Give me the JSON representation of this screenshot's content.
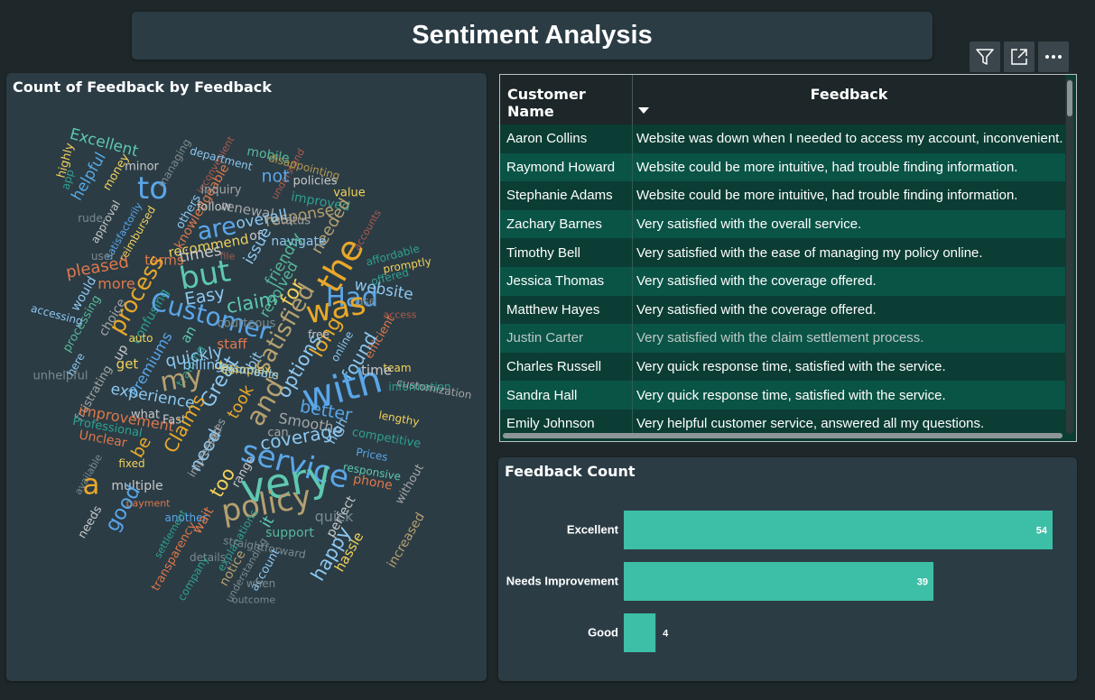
{
  "header": {
    "title": "Sentiment Analysis"
  },
  "toolbar": {
    "icons": [
      "filter-icon",
      "focus-mode-icon",
      "more-options-icon"
    ]
  },
  "wordcloud": {
    "title": "Count of Feedback by Feedback",
    "words": [
      {
        "t": "Excellent",
        "c": "#5ec8b0",
        "s": 17,
        "r": 15
      },
      {
        "t": "highly",
        "c": "#f3d25a",
        "s": 13,
        "r": -75
      },
      {
        "t": "app",
        "c": "#2fa08f",
        "s": 12,
        "r": -75
      },
      {
        "t": "helpful",
        "c": "#58a8e0",
        "s": 17,
        "r": -60
      },
      {
        "t": "money",
        "c": "#f3d25a",
        "s": 13,
        "r": -60
      },
      {
        "t": "minor",
        "c": "#c9c9c9",
        "s": 13,
        "r": 0
      },
      {
        "t": "to",
        "c": "#5aa6e8",
        "s": 34,
        "r": 0
      },
      {
        "t": "managing",
        "c": "#7a8a8f",
        "s": 12,
        "r": -60
      },
      {
        "t": "inconvenient",
        "c": "#b05a4a",
        "s": 11,
        "r": -60
      },
      {
        "t": "department",
        "c": "#8ec8f0",
        "s": 12,
        "r": 15
      },
      {
        "t": "mobile",
        "c": "#58b89a",
        "s": 14,
        "r": 10
      },
      {
        "t": "understand",
        "c": "#b05a4a",
        "s": 11,
        "r": -60
      },
      {
        "t": "not",
        "c": "#5aa6e8",
        "s": 19,
        "r": 0
      },
      {
        "t": "disappointing",
        "c": "#b59a50",
        "s": 12,
        "r": 15
      },
      {
        "t": "knowledgeable",
        "c": "#e0784a",
        "s": 14,
        "r": -60
      },
      {
        "t": "inquiry",
        "c": "#a5a5a5",
        "s": 13,
        "r": 0
      },
      {
        "t": "policies",
        "c": "#c9c9c9",
        "s": 13,
        "r": 0
      },
      {
        "t": "value",
        "c": "#f3d25a",
        "s": 13,
        "r": 0
      },
      {
        "t": "improved",
        "c": "#2fa08f",
        "s": 14,
        "r": 10
      },
      {
        "t": "follow",
        "c": "#c9c9c9",
        "s": 13,
        "r": 0
      },
      {
        "t": "renewal",
        "c": "#a5a5a5",
        "s": 15,
        "r": 10
      },
      {
        "t": "response",
        "c": "#b5a070",
        "s": 17,
        "r": -10
      },
      {
        "t": "rude",
        "c": "#7a8a8f",
        "s": 12,
        "r": 0
      },
      {
        "t": "approval",
        "c": "#c9c9c9",
        "s": 12,
        "r": -60
      },
      {
        "t": "satisfactorily",
        "c": "#5aa6e8",
        "s": 11,
        "r": -60
      },
      {
        "t": "reimbursed",
        "c": "#f3d25a",
        "s": 12,
        "r": -60
      },
      {
        "t": "others",
        "c": "#8ec8f0",
        "s": 13,
        "r": -60
      },
      {
        "t": "are",
        "c": "#5aa6e8",
        "s": 27,
        "r": -10
      },
      {
        "t": "overall",
        "c": "#8ec8f0",
        "s": 17,
        "r": -10
      },
      {
        "t": "status",
        "c": "#a5a5a5",
        "s": 13,
        "r": 0
      },
      {
        "t": "needed",
        "c": "#b5a070",
        "s": 18,
        "r": -60
      },
      {
        "t": "accounts",
        "c": "#b05a4a",
        "s": 11,
        "r": -60
      },
      {
        "t": "recommend",
        "c": "#f3d25a",
        "s": 15,
        "r": -10
      },
      {
        "t": "of",
        "c": "#c9c9c9",
        "s": 14,
        "r": 0
      },
      {
        "t": "navigate",
        "c": "#8ec8f0",
        "s": 14,
        "r": 0
      },
      {
        "t": "the",
        "c": "#e8a82a",
        "s": 38,
        "r": -60
      },
      {
        "t": "affordable",
        "c": "#2fa08f",
        "s": 12,
        "r": -15
      },
      {
        "t": "user",
        "c": "#7a8a8f",
        "s": 12,
        "r": 0
      },
      {
        "t": "times",
        "c": "#c9c9c9",
        "s": 17,
        "r": -10
      },
      {
        "t": "file",
        "c": "#b05a4a",
        "s": 11,
        "r": 0
      },
      {
        "t": "issue",
        "c": "#8ec8f0",
        "s": 17,
        "r": -60
      },
      {
        "t": "friendly",
        "c": "#58b89a",
        "s": 17,
        "r": -60
      },
      {
        "t": "promptly",
        "c": "#f3d25a",
        "s": 12,
        "r": -10
      },
      {
        "t": "pleased",
        "c": "#e0784a",
        "s": 18,
        "r": -10
      },
      {
        "t": "terms",
        "c": "#e0784a",
        "s": 15,
        "r": 0
      },
      {
        "t": "but",
        "c": "#5ec8b0",
        "s": 34,
        "r": -10
      },
      {
        "t": "offered",
        "c": "#2fa08f",
        "s": 12,
        "r": -15
      },
      {
        "t": "would",
        "c": "#8ec8f0",
        "s": 14,
        "r": -60
      },
      {
        "t": "more",
        "c": "#e0784a",
        "s": 16,
        "r": 0
      },
      {
        "t": "process",
        "c": "#e8a82a",
        "s": 25,
        "r": -60
      },
      {
        "t": "resolved",
        "c": "#58b89a",
        "s": 16,
        "r": -60
      },
      {
        "t": "Had",
        "c": "#5aa6e8",
        "s": 29,
        "r": 0
      },
      {
        "t": "ease",
        "c": "#7a8a8f",
        "s": 12,
        "r": 0
      },
      {
        "t": "website",
        "c": "#8ec8f0",
        "s": 17,
        "r": 10
      },
      {
        "t": "Easy",
        "c": "#8ec8f0",
        "s": 19,
        "r": -10
      },
      {
        "t": "claim",
        "c": "#5ec8b0",
        "s": 21,
        "r": -10
      },
      {
        "t": "for",
        "c": "#f3d25a",
        "s": 22,
        "r": -60
      },
      {
        "t": "was",
        "c": "#e8a82a",
        "s": 34,
        "r": -10
      },
      {
        "t": "processing",
        "c": "#58b89a",
        "s": 13,
        "r": -60
      },
      {
        "t": "choice",
        "c": "#a5a5a5",
        "s": 14,
        "r": -60
      },
      {
        "t": "confusing",
        "c": "#2fa08f",
        "s": 14,
        "r": -60
      },
      {
        "t": "Customer",
        "c": "#5aa6e8",
        "s": 28,
        "r": 15
      },
      {
        "t": "courteous",
        "c": "#7a8a8f",
        "s": 13,
        "r": 0
      },
      {
        "t": "satisfied",
        "c": "#b5a070",
        "s": 26,
        "r": -60
      },
      {
        "t": "access",
        "c": "#b05a4a",
        "s": 11,
        "r": 0
      },
      {
        "t": "accessing",
        "c": "#8ec8f0",
        "s": 12,
        "r": 15
      },
      {
        "t": "up",
        "c": "#c9c9c9",
        "s": 14,
        "r": -60
      },
      {
        "t": "an",
        "c": "#5ec8b0",
        "s": 15,
        "r": -60
      },
      {
        "t": "staff",
        "c": "#e0784a",
        "s": 15,
        "r": 0
      },
      {
        "t": "long",
        "c": "#e8a82a",
        "s": 22,
        "r": -60
      },
      {
        "t": "free",
        "c": "#c9c9c9",
        "s": 12,
        "r": 0
      },
      {
        "t": "efficient",
        "c": "#e0784a",
        "s": 13,
        "r": -60
      },
      {
        "t": "auto",
        "c": "#f3d25a",
        "s": 12,
        "r": 0
      },
      {
        "t": "Premiums",
        "c": "#5aa6e8",
        "s": 16,
        "r": -60
      },
      {
        "t": "training",
        "c": "#2fa08f",
        "s": 13,
        "r": -60
      },
      {
        "t": "quickly",
        "c": "#8ec8f0",
        "s": 18,
        "r": -10
      },
      {
        "t": "options",
        "c": "#8ec8f0",
        "s": 21,
        "r": -60
      },
      {
        "t": "found",
        "c": "#8ec8f0",
        "s": 20,
        "r": -60
      },
      {
        "t": "online",
        "c": "#8ec8f0",
        "s": 12,
        "r": -60
      },
      {
        "t": "frustrating",
        "c": "#a5a5a5",
        "s": 13,
        "r": -60
      },
      {
        "t": "get",
        "c": "#f3d25a",
        "s": 15,
        "r": 0
      },
      {
        "t": "billing",
        "c": "#8ec8f0",
        "s": 15,
        "r": 0
      },
      {
        "t": "bit",
        "c": "#8ec8f0",
        "s": 15,
        "r": -60
      },
      {
        "t": "team",
        "c": "#f3d25a",
        "s": 12,
        "r": 0
      },
      {
        "t": "unhelpful",
        "c": "#7a8a8f",
        "s": 13,
        "r": 0
      },
      {
        "t": "here",
        "c": "#8ec8f0",
        "s": 12,
        "r": -60
      },
      {
        "t": "my",
        "c": "#b5a070",
        "s": 30,
        "r": -10
      },
      {
        "t": "Great",
        "c": "#8ec8f0",
        "s": 22,
        "r": -60
      },
      {
        "t": "with",
        "c": "#5aa6e8",
        "s": 42,
        "r": -15
      },
      {
        "t": "time",
        "c": "#c9c9c9",
        "s": 15,
        "r": 0
      },
      {
        "t": "information",
        "c": "#2fa08f",
        "s": 12,
        "r": 0
      },
      {
        "t": "customization",
        "c": "#a5a5a5",
        "s": 12,
        "r": 10
      },
      {
        "t": "experience",
        "c": "#8ec8f0",
        "s": 17,
        "r": 10
      },
      {
        "t": "took",
        "c": "#e8a82a",
        "s": 18,
        "r": -60
      },
      {
        "t": "and",
        "c": "#b5a070",
        "s": 29,
        "r": -60
      },
      {
        "t": "better",
        "c": "#5aa6e8",
        "s": 19,
        "r": 10
      },
      {
        "t": "what",
        "c": "#c9c9c9",
        "s": 13,
        "r": 0
      },
      {
        "t": "improvement",
        "c": "#e0784a",
        "s": 16,
        "r": 10
      },
      {
        "t": "Fast",
        "c": "#c9c9c9",
        "s": 13,
        "r": 0
      },
      {
        "t": "Claims",
        "c": "#e8a82a",
        "s": 21,
        "r": -60
      },
      {
        "t": "rates",
        "c": "#a5a5a5",
        "s": 12,
        "r": -60
      },
      {
        "t": "Smooth",
        "c": "#a5a5a5",
        "s": 16,
        "r": 10
      },
      {
        "t": "high",
        "c": "#8ec8f0",
        "s": 14,
        "r": -60
      },
      {
        "t": "lengthy",
        "c": "#f3d25a",
        "s": 12,
        "r": 10
      },
      {
        "t": "Professional",
        "c": "#2fa08f",
        "s": 13,
        "r": 10
      },
      {
        "t": "coverage",
        "c": "#8ec8f0",
        "s": 20,
        "r": -10
      },
      {
        "t": "can",
        "c": "#a5a5a5",
        "s": 13,
        "r": 0
      },
      {
        "t": "competitive",
        "c": "#2fa08f",
        "s": 13,
        "r": 10
      },
      {
        "t": "Unclear",
        "c": "#e0784a",
        "s": 14,
        "r": 10
      },
      {
        "t": "be",
        "c": "#e8a82a",
        "s": 19,
        "r": -60
      },
      {
        "t": "service",
        "c": "#5aa6e8",
        "s": 34,
        "r": 15
      },
      {
        "t": "Prices",
        "c": "#5aa6e8",
        "s": 12,
        "r": 10
      },
      {
        "t": "need",
        "c": "#8ec8f0",
        "s": 20,
        "r": -60
      },
      {
        "t": "impressed",
        "c": "#a5a5a5",
        "s": 12,
        "r": -60
      },
      {
        "t": "fixed",
        "c": "#f3d25a",
        "s": 12,
        "r": 0
      },
      {
        "t": "responsive",
        "c": "#5ec8b0",
        "s": 12,
        "r": 10
      },
      {
        "t": "available",
        "c": "#7a8a8f",
        "s": 11,
        "r": -60
      },
      {
        "t": "a",
        "c": "#e8a82a",
        "s": 31,
        "r": 0
      },
      {
        "t": "range",
        "c": "#c9c9c9",
        "s": 13,
        "r": -60
      },
      {
        "t": "very",
        "c": "#5ec8b0",
        "s": 46,
        "r": -10
      },
      {
        "t": "phone",
        "c": "#e0784a",
        "s": 14,
        "r": 10
      },
      {
        "t": "without",
        "c": "#a5a5a5",
        "s": 13,
        "r": -60
      },
      {
        "t": "multiple",
        "c": "#c9c9c9",
        "s": 14,
        "r": 0
      },
      {
        "t": "too",
        "c": "#f3d25a",
        "s": 21,
        "r": -60
      },
      {
        "t": "payment",
        "c": "#e0784a",
        "s": 11,
        "r": 0
      },
      {
        "t": "policy",
        "c": "#b5a070",
        "s": 34,
        "r": -10
      },
      {
        "t": "perfect",
        "c": "#c9c9c9",
        "s": 14,
        "r": -60
      },
      {
        "t": "good",
        "c": "#5aa6e8",
        "s": 22,
        "r": -60
      },
      {
        "t": "another",
        "c": "#5aa6e8",
        "s": 12,
        "r": 0
      },
      {
        "t": "it",
        "c": "#5ec8b0",
        "s": 17,
        "r": -60
      },
      {
        "t": "quick",
        "c": "#7a8a8f",
        "s": 16,
        "r": 0
      },
      {
        "t": "needs",
        "c": "#c9c9c9",
        "s": 13,
        "r": -60
      },
      {
        "t": "settlement",
        "c": "#2fa08f",
        "s": 11,
        "r": -60
      },
      {
        "t": "wait",
        "c": "#e0784a",
        "s": 15,
        "r": -60
      },
      {
        "t": "support",
        "c": "#58b89a",
        "s": 14,
        "r": 0
      },
      {
        "t": "hassle",
        "c": "#f3d25a",
        "s": 15,
        "r": -60
      },
      {
        "t": "increased",
        "c": "#b5a070",
        "s": 14,
        "r": -60
      },
      {
        "t": "explanations",
        "c": "#2fa08f",
        "s": 12,
        "r": -60
      },
      {
        "t": "straightforward",
        "c": "#7a8a8f",
        "s": 12,
        "r": 10
      },
      {
        "t": "happy",
        "c": "#8ec8f0",
        "s": 21,
        "r": -60
      },
      {
        "t": "details",
        "c": "#7a8a8f",
        "s": 12,
        "r": 0
      },
      {
        "t": "notice",
        "c": "#b5a070",
        "s": 14,
        "r": -60
      },
      {
        "t": "account",
        "c": "#8ec8f0",
        "s": 13,
        "r": -60
      },
      {
        "t": "transparency",
        "c": "#e0784a",
        "s": 13,
        "r": -60
      },
      {
        "t": "company",
        "c": "#2fa08f",
        "s": 12,
        "r": -60
      },
      {
        "t": "understanding",
        "c": "#7a8a8f",
        "s": 11,
        "r": -60
      },
      {
        "t": "when",
        "c": "#7a8a8f",
        "s": 12,
        "r": 0
      },
      {
        "t": "outcome",
        "c": "#7a8a8f",
        "s": 11,
        "r": 0
      },
      {
        "t": "documents",
        "c": "#f3d25a",
        "s": 13,
        "r": 10
      },
      {
        "t": "complex",
        "c": "#f3d25a",
        "s": 13,
        "r": 0
      },
      {
        "t": "reasonable",
        "c": "#8ec8f0",
        "s": 13,
        "r": 10
      }
    ]
  },
  "table": {
    "headers": {
      "name": "Customer Name",
      "feedback": "Feedback"
    },
    "rows": [
      {
        "name": "Aaron Collins",
        "feedback": "Website was down when I needed to access my account, inconvenient."
      },
      {
        "name": "Raymond Howard",
        "feedback": "Website could be more intuitive, had trouble finding information."
      },
      {
        "name": "Stephanie Adams",
        "feedback": "Website could be more intuitive, had trouble finding information."
      },
      {
        "name": "Zachary Barnes",
        "feedback": "Very satisfied with the overall service."
      },
      {
        "name": "Timothy Bell",
        "feedback": "Very satisfied with the ease of managing my policy online."
      },
      {
        "name": "Jessica Thomas",
        "feedback": "Very satisfied with the coverage offered."
      },
      {
        "name": "Matthew Hayes",
        "feedback": "Very satisfied with the coverage offered."
      },
      {
        "name": "Justin Carter",
        "feedback": "Very satisfied with the claim settlement process."
      },
      {
        "name": "Charles Russell",
        "feedback": "Very quick response time, satisfied with the service."
      },
      {
        "name": "Sandra Hall",
        "feedback": "Very quick response time, satisfied with the service."
      },
      {
        "name": "Emily Johnson",
        "feedback": "Very helpful customer service, answered all my questions."
      }
    ]
  },
  "bar_chart": {
    "title": "Feedback Count",
    "bar_color": "#3dbfa7"
  },
  "chart_data": {
    "type": "bar",
    "orientation": "horizontal",
    "title": "Feedback Count",
    "categories": [
      "Excellent",
      "Needs Improvement",
      "Good"
    ],
    "values": [
      54,
      39,
      4
    ],
    "xlim": [
      0,
      54
    ]
  }
}
